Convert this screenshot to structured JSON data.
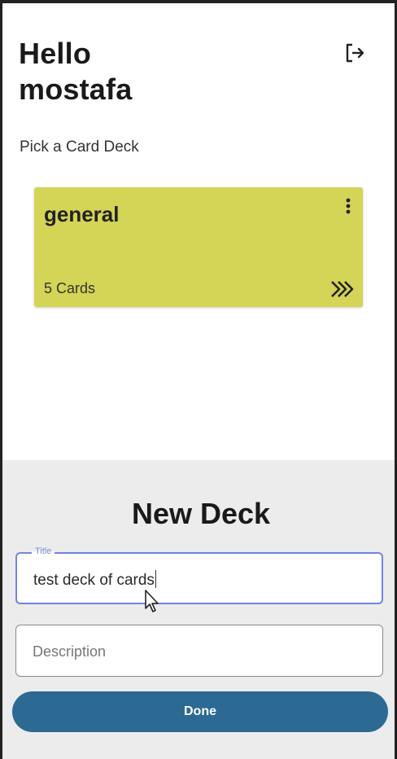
{
  "header": {
    "greeting_line1": "Hello",
    "greeting_line2": "mostafa",
    "logout_icon": "logout-icon"
  },
  "subtitle": "Pick a Card Deck",
  "decks": [
    {
      "title": "general",
      "count_label": "5 Cards",
      "color": "#d4d456",
      "menu_icon": "more-vertical-icon",
      "open_icon": "double-chevron-right-icon"
    }
  ],
  "new_deck_sheet": {
    "heading": "New Deck",
    "title_field": {
      "label": "Title",
      "value": "test deck of cards"
    },
    "description_field": {
      "placeholder": "Description",
      "value": ""
    },
    "done_label": "Done"
  },
  "colors": {
    "accent": "#2c6a93",
    "deck_card": "#d4d456",
    "focus_border": "#6f86e0",
    "sheet_background": "#ececec"
  }
}
